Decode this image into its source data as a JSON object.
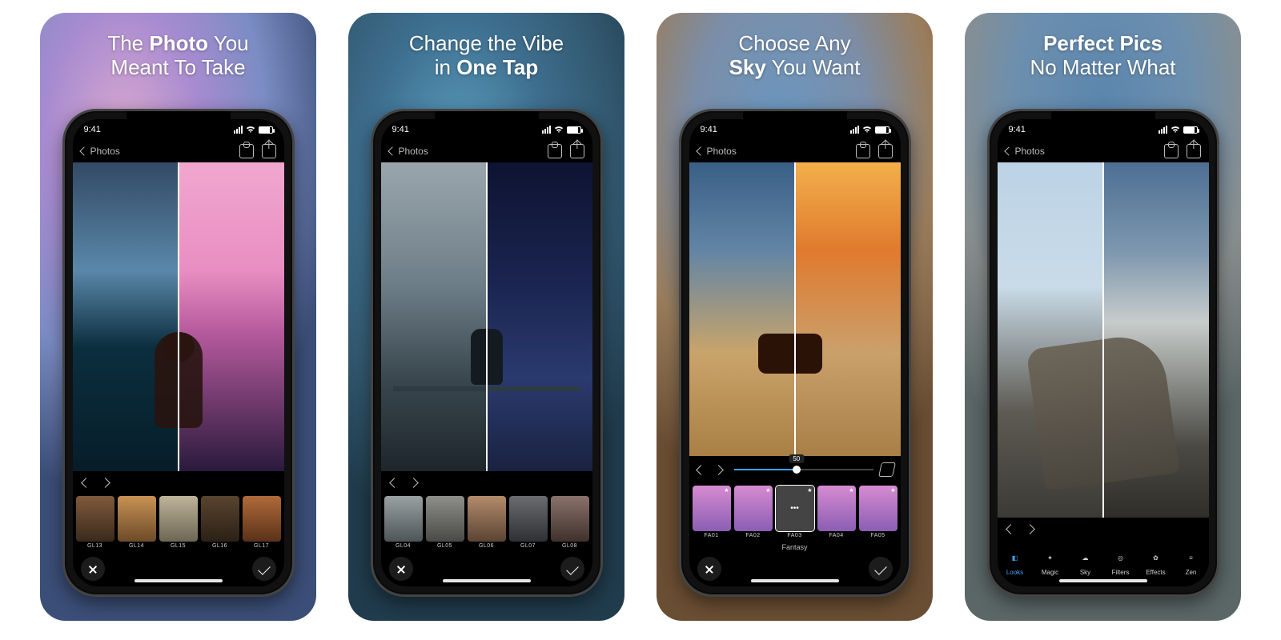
{
  "status": {
    "time": "9:41"
  },
  "nav": {
    "back_label": "Photos"
  },
  "panels": [
    {
      "title_pre": "The ",
      "title_bold": "Photo",
      "title_post": " You\nMeant To Take",
      "looks": [
        "GL13",
        "GL14",
        "GL15",
        "GL16",
        "GL17"
      ]
    },
    {
      "title_pre": "Change the Vibe\nin ",
      "title_bold": "One Tap",
      "title_post": "",
      "looks": [
        "GL04",
        "GL05",
        "GL06",
        "GL07",
        "GL08"
      ]
    },
    {
      "title_pre": "Choose Any\n",
      "title_bold": "Sky",
      "title_post": " You Want",
      "slider_value": "50",
      "sky_category": "Fantasy",
      "skies": [
        "FA01",
        "FA02",
        "FA03",
        "FA04",
        "FA05"
      ]
    },
    {
      "title_bold": "Perfect Pics",
      "title_post": "\nNo Matter What",
      "title_pre": "",
      "tabs": [
        "Looks",
        "Magic",
        "Sky",
        "Filters",
        "Effects",
        "Zen"
      ]
    }
  ]
}
